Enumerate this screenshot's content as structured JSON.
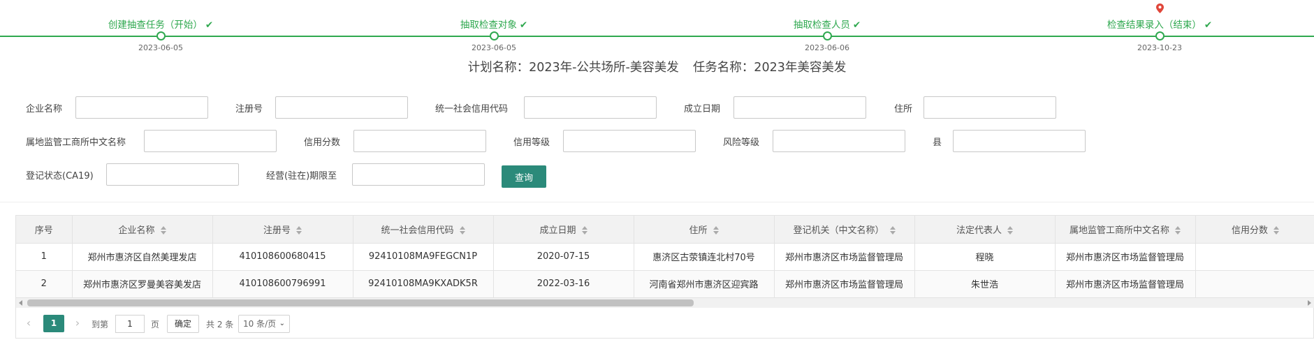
{
  "steps": [
    {
      "label": "创建抽查任务（开始）",
      "date": "2023-06-05",
      "done": true
    },
    {
      "label": "抽取检查对象",
      "date": "2023-06-05",
      "done": true
    },
    {
      "label": "抽取检查人员",
      "date": "2023-06-06",
      "done": true
    },
    {
      "label": "检查结果录入（结束）",
      "date": "2023-10-23",
      "done": true,
      "current": true
    }
  ],
  "plan": {
    "plan_name": "计划名称：2023年-公共场所-美容美发",
    "task_name": "任务名称：2023年美容美发"
  },
  "form": {
    "company_name": {
      "label": "企业名称",
      "value": ""
    },
    "reg_no": {
      "label": "注册号",
      "value": ""
    },
    "credit_code": {
      "label": "统一社会信用代码",
      "value": ""
    },
    "found_date": {
      "label": "成立日期",
      "value": ""
    },
    "address": {
      "label": "住所",
      "value": ""
    },
    "local_office": {
      "label": "属地监管工商所中文名称",
      "value": ""
    },
    "credit_score": {
      "label": "信用分数",
      "value": ""
    },
    "credit_level": {
      "label": "信用等级",
      "value": ""
    },
    "risk_level": {
      "label": "风险等级",
      "value": ""
    },
    "county": {
      "label": "县",
      "value": ""
    },
    "reg_status": {
      "label": "登记状态(CA19)",
      "value": ""
    },
    "term_until": {
      "label": "经营(驻在)期限至",
      "value": ""
    },
    "query_label": "查询"
  },
  "table": {
    "columns": [
      "序号",
      "企业名称",
      "注册号",
      "统一社会信用代码",
      "成立日期",
      "住所",
      "登记机关（中文名称）",
      "法定代表人",
      "属地监管工商所中文名称",
      "信用分数"
    ],
    "rows": [
      [
        "1",
        "郑州市惠济区自然美理发店",
        "410108600680415",
        "92410108MA9FEGCN1P",
        "2020-07-15",
        "惠济区古荥镇连北村70号",
        "郑州市惠济区市场监督管理局",
        "程晓",
        "郑州市惠济区市场监督管理局",
        ""
      ],
      [
        "2",
        "郑州市惠济区罗曼美容美发店",
        "410108600796991",
        "92410108MA9KXADK5R",
        "2022-03-16",
        "河南省郑州市惠济区迎宾路",
        "郑州市惠济区市场监督管理局",
        "朱世浩",
        "郑州市惠济区市场监督管理局",
        ""
      ]
    ]
  },
  "pager": {
    "prev_icon": "chevron-left-icon",
    "next_icon": "chevron-right-icon",
    "current_page": "1",
    "goto_label": "到第",
    "page_value": "1",
    "page_unit": "页",
    "confirm_label": "确定",
    "total_label": "共 2 条",
    "page_size_label": "10 条/页"
  },
  "colors": {
    "accent": "#2b8a7a",
    "step_green": "#2fa84f",
    "pin_red": "#e0463a"
  }
}
